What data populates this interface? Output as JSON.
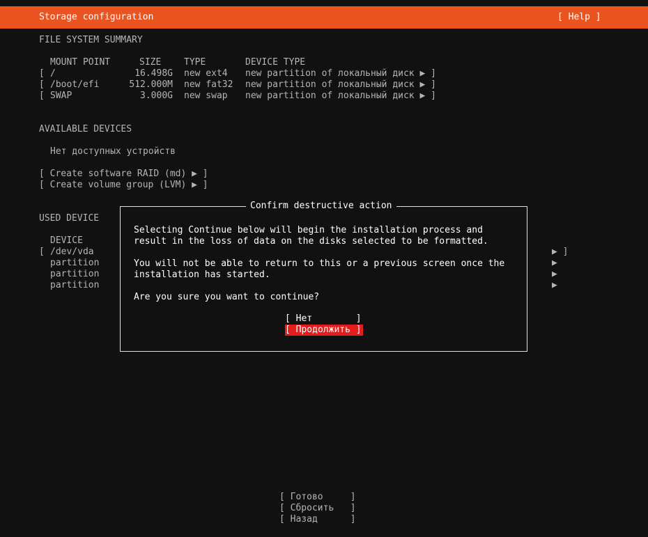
{
  "header": {
    "title": "Storage configuration",
    "help": "[ Help ]"
  },
  "fs_summary": {
    "heading": "FILE SYSTEM SUMMARY",
    "col_mount": "MOUNT POINT",
    "col_size": "SIZE",
    "col_type": "TYPE",
    "col_device_type": "DEVICE TYPE",
    "rows": [
      {
        "open": "[",
        "mount": "/",
        "size": "16.498G",
        "type": "new ext4",
        "device_type": "new partition of локальный диск ▶ ]"
      },
      {
        "open": "[",
        "mount": "/boot/efi",
        "size": "512.000M",
        "type": "new fat32",
        "device_type": "new partition of локальный диск ▶ ]"
      },
      {
        "open": "[",
        "mount": "SWAP",
        "size": "3.000G",
        "type": "new swap",
        "device_type": "new partition of локальный диск ▶ ]"
      }
    ]
  },
  "available": {
    "heading": "AVAILABLE DEVICES",
    "empty": "Нет доступных устройств",
    "raid": "[ Create software RAID (md) ▶ ]",
    "lvm": "[ Create volume group (LVM) ▶ ]"
  },
  "used": {
    "heading": "USED DEVICE",
    "col_device": "DEVICE",
    "rows": [
      {
        "open": "[",
        "name": "/dev/vda",
        "tail": "▶ ]"
      },
      {
        "open": "",
        "name": "partition",
        "tail": "▶"
      },
      {
        "open": "",
        "name": "partition",
        "tail": "▶"
      },
      {
        "open": "",
        "name": "partition",
        "tail": "▶"
      }
    ]
  },
  "dialog": {
    "title": "Confirm destructive action",
    "line1": "Selecting Continue below will begin the installation process and",
    "line2": "result in the loss of data on the disks selected to be formatted.",
    "line3": "You will not be able to return to this or a previous screen once the",
    "line4": "installation has started.",
    "line5": "Are you sure you want to continue?",
    "no_button": "[ Нет        ]",
    "yes_button": "[ Продолжить ]"
  },
  "footer": {
    "done": "[ Готово     ]",
    "reset": "[ Сбросить   ]",
    "back": "[ Назад      ]"
  },
  "colors": {
    "accent": "#e95420",
    "selected_button": "#e31c1c",
    "background": "#111111"
  }
}
